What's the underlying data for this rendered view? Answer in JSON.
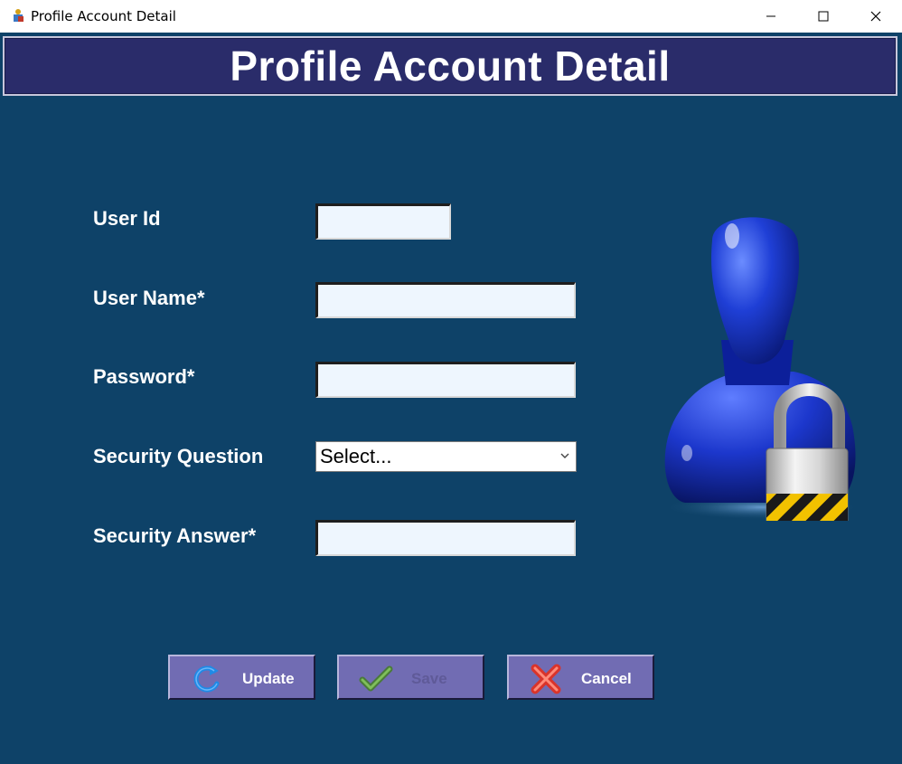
{
  "window": {
    "title": "Profile Account Detail",
    "controls": [
      "minimize",
      "maximize",
      "close"
    ]
  },
  "header": {
    "title": "Profile Account Detail"
  },
  "form": {
    "user_id": {
      "label": "User Id",
      "value": ""
    },
    "user_name": {
      "label": "User Name*",
      "value": ""
    },
    "password": {
      "label": "Password*",
      "value": ""
    },
    "security_question": {
      "label": "Security Question",
      "selected": "Select..."
    },
    "security_answer": {
      "label": "Security Answer*",
      "value": ""
    }
  },
  "buttons": {
    "update": {
      "label": "Update",
      "icon": "refresh-arrow-icon",
      "enabled": true
    },
    "save": {
      "label": "Save",
      "icon": "checkmark-icon",
      "enabled": false
    },
    "cancel": {
      "label": "Cancel",
      "icon": "red-x-icon",
      "enabled": true
    }
  },
  "illustration": {
    "icon": "user-padlock-icon"
  },
  "colors": {
    "background": "#0e4268",
    "header_bg": "#2a2c6a",
    "button_bg": "#716cb3",
    "field_bg": "#eef6fe"
  }
}
